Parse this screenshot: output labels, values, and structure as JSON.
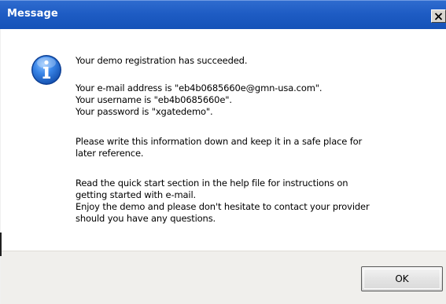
{
  "window": {
    "title": "Message",
    "close_glyph": "✕"
  },
  "message": {
    "icon": "info-icon",
    "lines": [
      "Your demo registration has succeeded.",
      "Your e-mail address is \"eb4b0685660e@gmn-usa.com\".",
      "Your username is \"eb4b0685660e\".",
      "Your password is \"xgatedemo\".",
      "Please write this information down and keep it in a safe place for",
      "later reference.",
      "Read the quick start section in the help file for instructions on",
      "getting started with e-mail.",
      "Enjoy the demo and please don't hesitate to contact your provider",
      "should you have any questions."
    ]
  },
  "buttons": {
    "ok_label": "OK"
  },
  "colors": {
    "titlebar": "#1e5cc4",
    "icon_blue": "#2a6fd6",
    "footer": "#f0efec"
  }
}
